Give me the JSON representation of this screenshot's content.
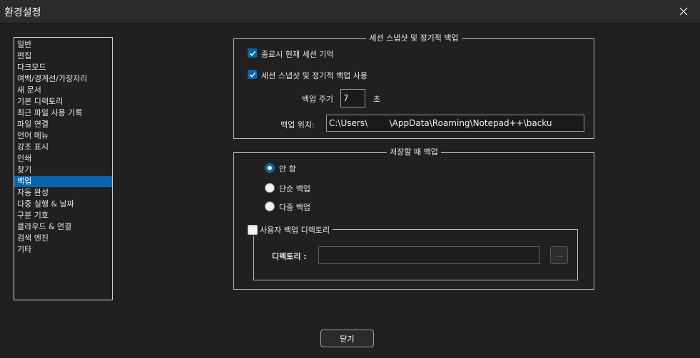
{
  "window": {
    "title": "환경설정"
  },
  "sidebar": {
    "items": [
      {
        "label": "일반"
      },
      {
        "label": "편집"
      },
      {
        "label": "다크모드"
      },
      {
        "label": "여백/경계선/가장자리"
      },
      {
        "label": "새 문서"
      },
      {
        "label": "기본 디렉토리"
      },
      {
        "label": "최근 파일 사용 기록"
      },
      {
        "label": "파일 연결"
      },
      {
        "label": "언어 메뉴"
      },
      {
        "label": "강조 표시"
      },
      {
        "label": "인쇄"
      },
      {
        "label": "찾기"
      },
      {
        "label": "백업",
        "selected": true
      },
      {
        "label": "자동 완성"
      },
      {
        "label": "다중 실행 & 날짜"
      },
      {
        "label": "구분 기호"
      },
      {
        "label": "클라우드 & 연결"
      },
      {
        "label": "검색 엔진"
      },
      {
        "label": "기타"
      }
    ]
  },
  "session": {
    "legend": "세션 스냅샷 및 정기적 백업",
    "remember_label": "종료시 현재 세션 기억",
    "remember_checked": true,
    "snapshot_label": "세션 스냅샷 및 정기적 백업 사용",
    "snapshot_checked": true,
    "period_label": "백업 주기",
    "period_value": "7",
    "period_unit": "초",
    "location_label": "백업 위치:",
    "location_value": "C:\\Users\\        \\AppData\\Roaming\\Notepad++\\backu"
  },
  "onsave": {
    "legend": "저장할 때 백업",
    "options": [
      {
        "label": "안 함",
        "selected": true
      },
      {
        "label": "단순 백업",
        "selected": false
      },
      {
        "label": "다중 백업",
        "selected": false
      }
    ],
    "custom_dir_label": "사용자 백업 디렉토리",
    "custom_dir_checked": false,
    "dir_label": "디렉토리 :",
    "dir_value": "",
    "browse_label": "..."
  },
  "footer": {
    "close_label": "닫기"
  },
  "colors": {
    "accent": "#0a64ad",
    "background": "#202020",
    "text": "#e6e6e6"
  }
}
